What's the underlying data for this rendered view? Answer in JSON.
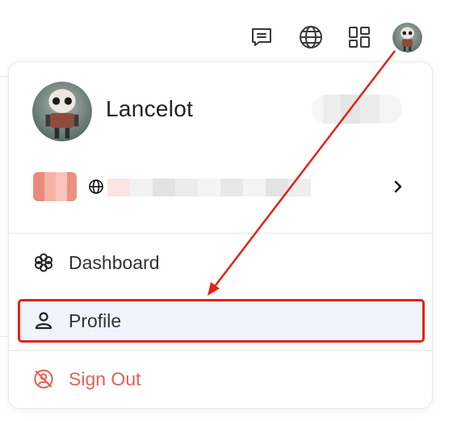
{
  "topbar": {
    "icons": [
      "message-icon",
      "globe-icon",
      "apps-grid-icon",
      "avatar"
    ]
  },
  "menu": {
    "user": {
      "name": "Lancelot"
    },
    "items": [
      {
        "label": "Dashboard",
        "icon": "dashboard-flower-icon"
      },
      {
        "label": "Profile",
        "icon": "user-icon",
        "active": true
      },
      {
        "label": "Sign Out",
        "icon": "sign-out-icon",
        "danger": true
      }
    ]
  },
  "colors": {
    "highlight_border": "#e2231a",
    "active_bg": "#eef5fd",
    "danger_text": "#e0625a",
    "arrow": "#e2231a"
  }
}
